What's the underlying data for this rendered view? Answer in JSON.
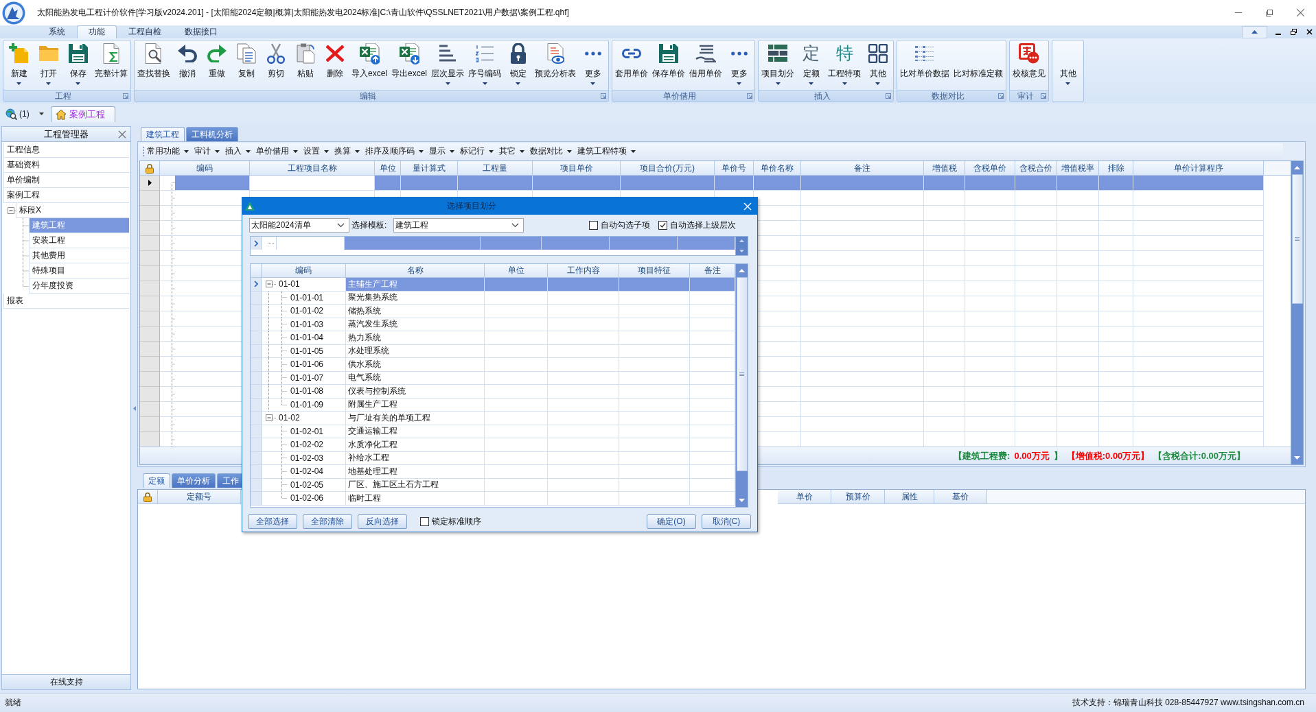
{
  "window": {
    "title": "太阳能热发电工程计价软件[学习版v2024.201] - [太阳能2024定额|概算|太阳能热发电2024标准|C:\\青山软件\\QSSLNET2021\\用户数据\\案例工程.qhf]"
  },
  "menu_tabs": [
    {
      "label": "系统",
      "selected": false
    },
    {
      "label": "功能",
      "selected": true
    },
    {
      "label": "工程自检",
      "selected": false
    },
    {
      "label": "数据接口",
      "selected": false
    }
  ],
  "ribbon": {
    "groups": [
      {
        "label": "工程",
        "launcher": true,
        "buttons": [
          {
            "label": "新建",
            "kind": "new",
            "dropdown": true
          },
          {
            "label": "打开",
            "kind": "open",
            "dropdown": true
          },
          {
            "label": "保存",
            "kind": "save",
            "dropdown": true
          },
          {
            "label": "完整计算",
            "kind": "calc",
            "dropdown": false
          }
        ]
      },
      {
        "label": "编辑",
        "launcher": true,
        "buttons": [
          {
            "label": "查找替换",
            "kind": "find",
            "dropdown": false
          },
          {
            "label": "撤消",
            "kind": "undo",
            "dropdown": false
          },
          {
            "label": "重做",
            "kind": "redo",
            "dropdown": false
          },
          {
            "label": "复制",
            "kind": "copy",
            "dropdown": false
          },
          {
            "label": "剪切",
            "kind": "cut",
            "dropdown": false
          },
          {
            "label": "粘贴",
            "kind": "paste",
            "dropdown": false
          },
          {
            "label": "删除",
            "kind": "delete",
            "dropdown": false
          },
          {
            "label": "导入excel",
            "kind": "import",
            "dropdown": false
          },
          {
            "label": "导出excel",
            "kind": "export",
            "dropdown": false
          },
          {
            "label": "层次显示",
            "kind": "levels",
            "dropdown": true
          },
          {
            "label": "序号编码",
            "kind": "numbering",
            "dropdown": true
          },
          {
            "label": "锁定",
            "kind": "lock",
            "dropdown": true
          },
          {
            "label": "预览分析表",
            "kind": "preview",
            "dropdown": false
          },
          {
            "label": "更多",
            "kind": "more",
            "dropdown": true
          }
        ]
      },
      {
        "label": "单价借用",
        "launcher": true,
        "buttons": [
          {
            "label": "套用单价",
            "kind": "link",
            "dropdown": false
          },
          {
            "label": "保存单价",
            "kind": "save",
            "dropdown": false
          },
          {
            "label": "借用单价",
            "kind": "borrow",
            "dropdown": false
          },
          {
            "label": "更多",
            "kind": "more",
            "dropdown": true
          }
        ]
      },
      {
        "label": "插入",
        "launcher": true,
        "buttons": [
          {
            "label": "项目划分",
            "kind": "divide",
            "dropdown": true
          },
          {
            "label": "定额",
            "kind": "glyph",
            "glyph": "定",
            "color": "#4a6474",
            "dropdown": true
          },
          {
            "label": "工程特项",
            "kind": "glyph",
            "glyph": "特",
            "color": "#1e8c8c",
            "dropdown": true
          },
          {
            "label": "其他",
            "kind": "grid",
            "dropdown": true
          }
        ]
      },
      {
        "label": "数据对比",
        "launcher": true,
        "buttons": [
          {
            "label": "比对单价数据",
            "kind": "compare",
            "dropdown": false
          },
          {
            "label": "比对标准定额",
            "kind": "none",
            "dropdown": false
          }
        ]
      },
      {
        "label": "审计",
        "launcher": true,
        "buttons": [
          {
            "label": "校核意见",
            "kind": "audit",
            "dropdown": false
          }
        ]
      },
      {
        "launcher": false,
        "buttons": [
          {
            "label": "其他",
            "kind": "none",
            "dropdown": true
          }
        ]
      }
    ]
  },
  "doc_bar": {
    "search_count": "(1)",
    "tabs": [
      {
        "label": "案例工程",
        "selected": true
      }
    ]
  },
  "project_manager": {
    "title": "工程管理器",
    "items": [
      {
        "label": "工程信息",
        "selected": false
      },
      {
        "label": "基础资料",
        "selected": false
      },
      {
        "label": "单价编制",
        "selected": false
      },
      {
        "label": "案例工程",
        "selected": false
      },
      {
        "label": "标段X",
        "selected": false,
        "expanded": true,
        "children": [
          {
            "label": "建筑工程",
            "selected": true
          },
          {
            "label": "安装工程",
            "selected": false
          },
          {
            "label": "其他费用",
            "selected": false
          },
          {
            "label": "特殊项目",
            "selected": false
          },
          {
            "label": "分年度投资",
            "selected": false
          }
        ]
      },
      {
        "label": "报表",
        "selected": false
      }
    ],
    "footer": "在线支持"
  },
  "main": {
    "tabs": [
      {
        "label": "建筑工程",
        "selected": true
      },
      {
        "label": "工料机分析",
        "selected": false
      }
    ],
    "toolbar": [
      "常用功能",
      "审计",
      "插入",
      "单价借用",
      "设置",
      "换算",
      "排序及顺序码",
      "显示",
      "标记行",
      "其它",
      "数据对比",
      "建筑工程特项"
    ],
    "grid": {
      "columns": [
        {
          "label": "编码",
          "current": false
        },
        {
          "label": "工程项目名称",
          "current": true
        },
        {
          "label": "单位",
          "current": false
        },
        {
          "label": "量计算式",
          "current": false
        },
        {
          "label": "工程量",
          "current": false
        },
        {
          "label": "项目单价",
          "current": false
        },
        {
          "label": "项目合价(万元)",
          "current": false
        },
        {
          "label": "单价号",
          "current": false
        },
        {
          "label": "单价名称",
          "current": false
        },
        {
          "label": "备注",
          "current": false
        },
        {
          "label": "增值税",
          "current": false
        },
        {
          "label": "含税单价",
          "current": false
        },
        {
          "label": "含税合价",
          "current": false
        },
        {
          "label": "增值税率",
          "current": false
        },
        {
          "label": "排除",
          "current": false
        },
        {
          "label": "单价计算程序",
          "current": false
        }
      ],
      "rows": [
        {
          "selected": true
        },
        {
          "selected": false
        },
        {
          "selected": false
        },
        {
          "selected": false
        },
        {
          "selected": false
        },
        {
          "selected": false
        },
        {
          "selected": false
        },
        {
          "selected": false
        },
        {
          "selected": false
        },
        {
          "selected": false
        },
        {
          "selected": false
        },
        {
          "selected": false
        },
        {
          "selected": false
        },
        {
          "selected": false
        },
        {
          "selected": false
        },
        {
          "selected": false
        },
        {
          "selected": false
        },
        {
          "selected": false
        }
      ]
    },
    "summary": [
      {
        "text": "【建筑工程费:",
        "color": "#1e8b3f"
      },
      {
        "text": "0.00万元",
        "color": "#ff0000"
      },
      {
        "text": "】",
        "color": "#1e8b3f"
      },
      {
        "text": "【增值税:0.00万元】",
        "color": "#ff0000"
      },
      {
        "text": "【含税合计:0.00万元】",
        "color": "#1e8b3f"
      }
    ]
  },
  "detail": {
    "tabs": [
      {
        "label": "定额",
        "selected": true
      },
      {
        "label": "单价分析",
        "selected": false
      },
      {
        "label": "工作",
        "selected": false
      }
    ],
    "columns": [
      "定额号",
      "单价",
      "预算价",
      "属性",
      "基价"
    ]
  },
  "dialog": {
    "title": "选择项目划分",
    "library": "太阳能2024清单",
    "template_label": "选择模板:",
    "template": "建筑工程",
    "options": [
      {
        "label": "自动勾选子项",
        "checked": false
      },
      {
        "label": "自动选择上级层次",
        "checked": true
      }
    ],
    "filter_row": {
      "selected": true
    },
    "columns": [
      "编码",
      "名称",
      "单位",
      "工作内容",
      "项目特征",
      "备注"
    ],
    "rows": [
      {
        "code": "01-01",
        "name": "主辅生产工程",
        "selected": true,
        "expanded": true,
        "children": [
          {
            "code": "01-01-01",
            "name": "聚光集热系统",
            "selected": false
          },
          {
            "code": "01-01-02",
            "name": "储热系统",
            "selected": false
          },
          {
            "code": "01-01-03",
            "name": "蒸汽发生系统",
            "selected": false
          },
          {
            "code": "01-01-04",
            "name": "热力系统",
            "selected": false
          },
          {
            "code": "01-01-05",
            "name": "水处理系统",
            "selected": false
          },
          {
            "code": "01-01-06",
            "name": "供水系统",
            "selected": false
          },
          {
            "code": "01-01-07",
            "name": "电气系统",
            "selected": false
          },
          {
            "code": "01-01-08",
            "name": "仪表与控制系统",
            "selected": false
          },
          {
            "code": "01-01-09",
            "name": "附属生产工程",
            "selected": false
          }
        ]
      },
      {
        "code": "01-02",
        "name": "与厂址有关的单项工程",
        "selected": false,
        "expanded": true,
        "children": [
          {
            "code": "01-02-01",
            "name": "交通运输工程",
            "selected": false
          },
          {
            "code": "01-02-02",
            "name": "水质净化工程",
            "selected": false
          },
          {
            "code": "01-02-03",
            "name": "补给水工程",
            "selected": false
          },
          {
            "code": "01-02-04",
            "name": "地基处理工程",
            "selected": false
          },
          {
            "code": "01-02-05",
            "name": "厂区、施工区土石方工程",
            "selected": false
          },
          {
            "code": "01-02-06",
            "name": "临时工程",
            "selected": false
          }
        ]
      }
    ],
    "actions": [
      "全部选择",
      "全部清除",
      "反向选择"
    ],
    "lock_order": {
      "label": "锁定标准顺序",
      "checked": false
    },
    "buttons": [
      "确定(O)",
      "取消(C)"
    ]
  },
  "status_bar": {
    "left": "就绪",
    "right": "技术支持：锦瑞青山科技 028-85447927 www.tsingshan.com.cn"
  }
}
